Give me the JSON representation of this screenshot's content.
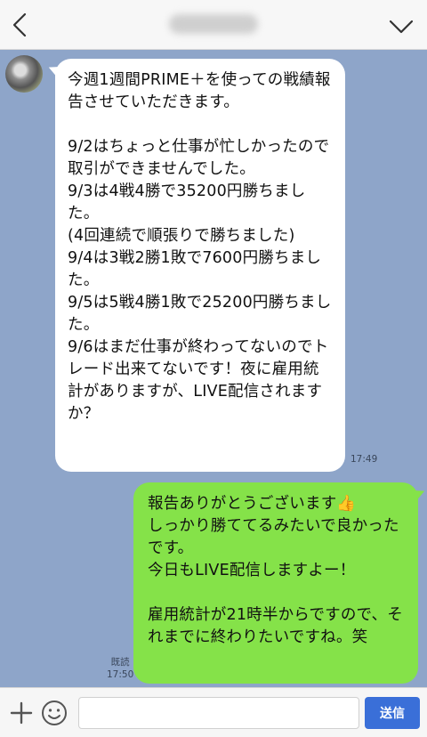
{
  "header": {
    "title": "",
    "back_icon": "chevron-left-icon",
    "menu_icon": "chevron-down-icon"
  },
  "messages": [
    {
      "direction": "incoming",
      "text": "今週1週間PRIME＋を使っての戦績報告させていただきます。\n\n9/2はちょっと仕事が忙しかったので取引ができませんでした。\n9/3は4戦4勝で35200円勝ちました。\n(4回連続で順張りで勝ちました)\n9/4は3戦2勝1敗で7600円勝ちました。\n9/5は5戦4勝1敗で25200円勝ちました。\n9/6はまだ仕事が終わってないのでトレード出来てないです！夜に雇用統計がありますが、LIVE配信されますか？",
      "time": "17:49"
    },
    {
      "direction": "outgoing",
      "text": "報告ありがとうございます👍\nしっかり勝ててるみたいで良かったです。\n今日もLIVE配信しますよー！\n\n雇用統計が21時半からですので、それまでに終わりたいですね。笑",
      "read_label": "既読",
      "time": "17:50"
    }
  ],
  "input_bar": {
    "plus_icon": "plus-icon",
    "emoji_icon": "smiley-icon",
    "input_value": "",
    "send_label": "送信"
  },
  "colors": {
    "background": "#8ea5c9",
    "incoming_bubble": "#ffffff",
    "outgoing_bubble": "#85e249",
    "send_button": "#3a6fd8"
  }
}
